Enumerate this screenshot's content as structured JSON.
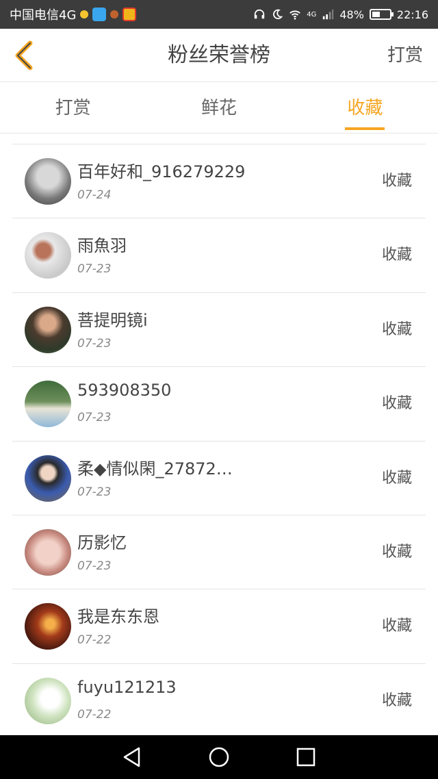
{
  "status_bar": {
    "carrier": "中国电信4G",
    "network": "4G",
    "battery_percent": "48%",
    "battery_level": 0.48,
    "time": "22:16"
  },
  "header": {
    "title": "粉丝荣誉榜",
    "action": "打赏"
  },
  "tabs": [
    {
      "label": "打赏",
      "active": false
    },
    {
      "label": "鲜花",
      "active": false
    },
    {
      "label": "收藏",
      "active": true
    }
  ],
  "colors": {
    "accent": "#f5a623",
    "status_bar": "#3c3c3c"
  },
  "list": [
    {
      "name": "百年好和_916279229",
      "date": "07-24",
      "action": "收藏"
    },
    {
      "name": "雨魚羽",
      "date": "07-23",
      "action": "收藏"
    },
    {
      "name": "菩提明镜i",
      "date": "07-23",
      "action": "收藏"
    },
    {
      "name": "593908350",
      "date": "07-23",
      "action": "收藏"
    },
    {
      "name": "柔◆情似閑_27872…",
      "date": "07-23",
      "action": "收藏"
    },
    {
      "name": "历影忆",
      "date": "07-23",
      "action": "收藏"
    },
    {
      "name": "我是东东恩",
      "date": "07-22",
      "action": "收藏"
    },
    {
      "name": "fuyu121213",
      "date": "07-22",
      "action": "收藏"
    }
  ]
}
